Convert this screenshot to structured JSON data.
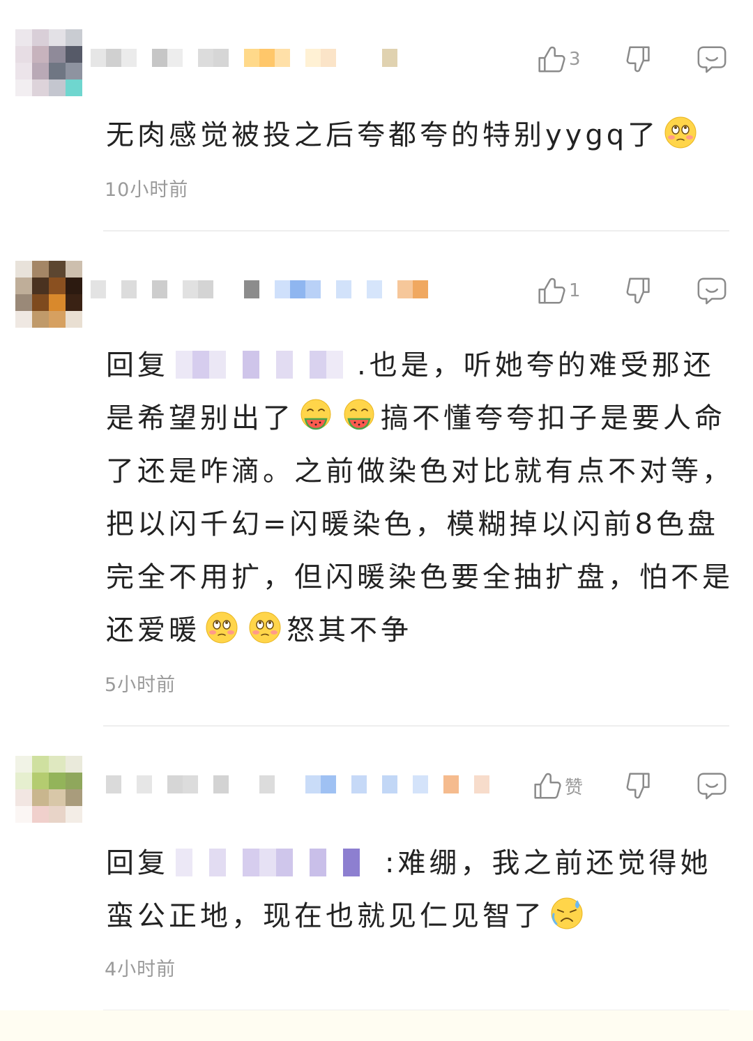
{
  "comments": [
    {
      "likes": "3",
      "text_parts": [
        "无肉感觉被投之后夸都夸的特别yygq了"
      ],
      "time": "10小时前"
    },
    {
      "likes": "1",
      "reply_prefix": "回复",
      "text_parts": [
        ".也是，听她夸的难受那还是希望别出了",
        "搞不懂夸夸扣子是要人命了还是咋滴。之前做染色对比就有点不对等，把以闪千幻=闪暖染色，模糊掉以闪前8色盘完全不用扩，但闪暖染色要全抽扩盘，怕不是还爱暖",
        "怒其不争"
      ],
      "time": "5小时前"
    },
    {
      "likes": "赞",
      "reply_prefix": "回复",
      "text_parts": [
        ":难绷，我之前还觉得她蛮公正地，现在也就见仁见智了"
      ],
      "time": "4小时前"
    }
  ],
  "icons": [
    "thumb-up-icon",
    "thumb-down-icon",
    "comment-bubble-icon",
    "shy-face-emoji",
    "watermelon-face-emoji",
    "sweat-face-emoji"
  ],
  "colors": {
    "text": "#222222",
    "meta": "#9a9a9a",
    "divider": "#eeeeee",
    "emoji": "#ffd54a"
  }
}
